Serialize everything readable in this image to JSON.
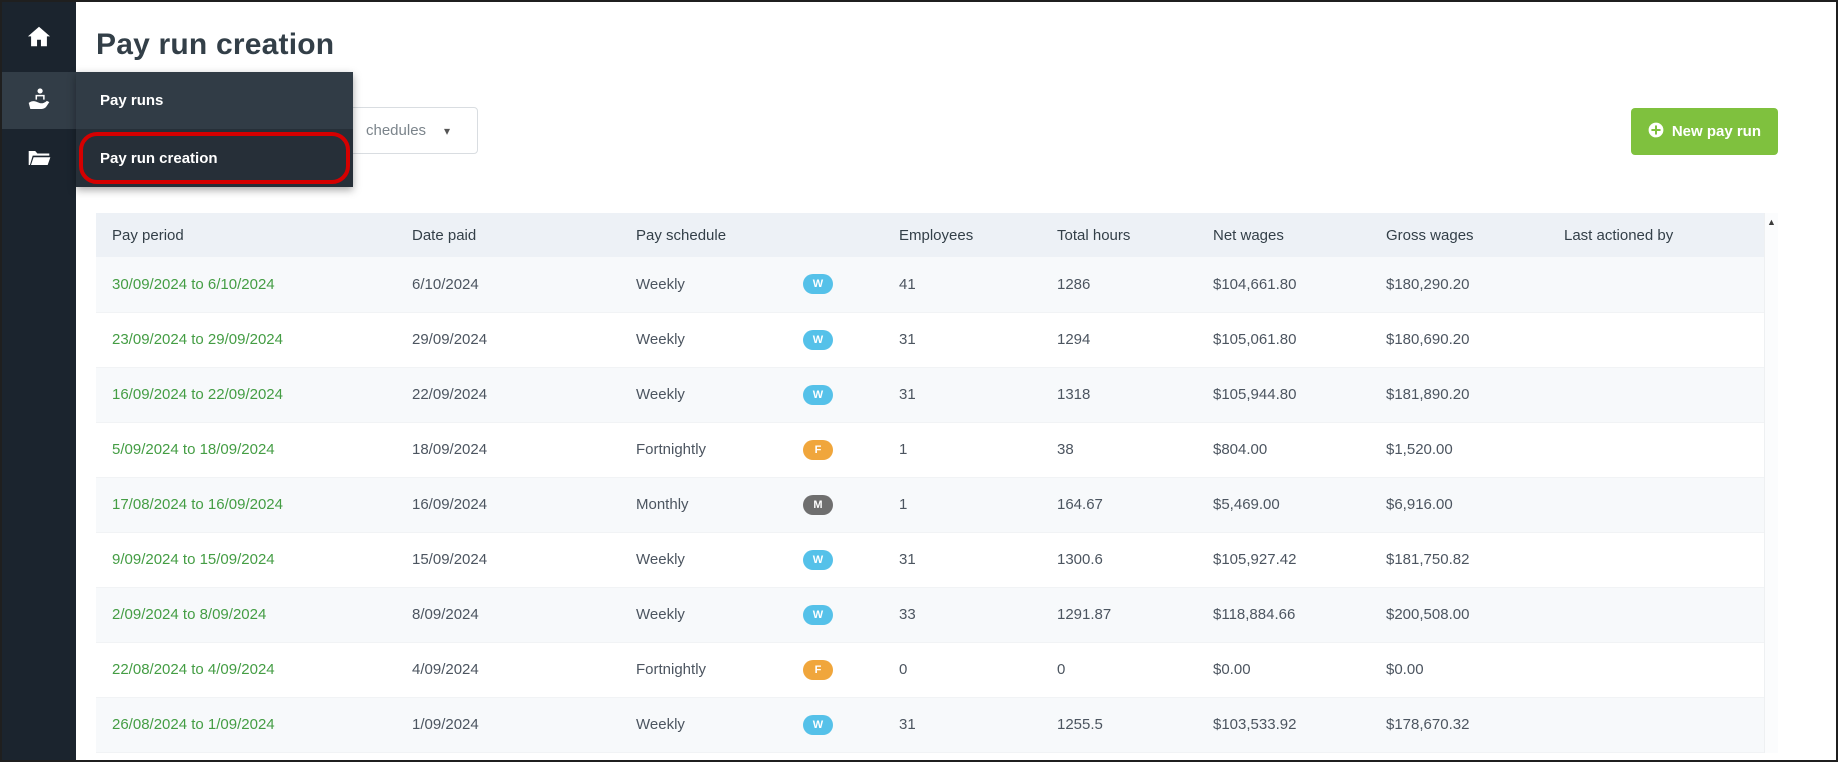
{
  "page": {
    "title": "Pay run creation"
  },
  "sidebar": {
    "icons": [
      "home",
      "pay-runs",
      "documents"
    ]
  },
  "flyout": {
    "items": [
      {
        "label": "Pay runs"
      },
      {
        "label": "Pay run creation",
        "annotated": true
      }
    ]
  },
  "toolbar": {
    "schedule_filter_visible_text": "chedules",
    "caret_glyph": "▾",
    "new_pay_run_label": "New pay run"
  },
  "scrollbar": {
    "up_arrow": "▲"
  },
  "colors": {
    "sidebar_bg": "#1b242e",
    "flyout_bg": "#313c46",
    "button_green": "#7fc13e",
    "link_green": "#449d44",
    "annotation_red": "#d50000",
    "badge_weekly": "#55c1e9",
    "badge_fortnightly": "#f0a63c",
    "badge_monthly": "#6f6f6f",
    "table_header_bg": "#edf1f6"
  },
  "table": {
    "headers": [
      "Pay period",
      "Date paid",
      "Pay schedule",
      "Employees",
      "Total hours",
      "Net wages",
      "Gross wages",
      "Last actioned by"
    ],
    "rows": [
      {
        "pay_period": "30/09/2024 to 6/10/2024",
        "date_paid": "6/10/2024",
        "schedule": "Weekly",
        "badge_letter": "W",
        "badge_color": "#55c1e9",
        "employees": "41",
        "total_hours": "1286",
        "net_wages": "$104,661.80",
        "gross_wages": "$180,290.20",
        "last_actioned_by": ""
      },
      {
        "pay_period": "23/09/2024 to 29/09/2024",
        "date_paid": "29/09/2024",
        "schedule": "Weekly",
        "badge_letter": "W",
        "badge_color": "#55c1e9",
        "employees": "31",
        "total_hours": "1294",
        "net_wages": "$105,061.80",
        "gross_wages": "$180,690.20",
        "last_actioned_by": ""
      },
      {
        "pay_period": "16/09/2024 to 22/09/2024",
        "date_paid": "22/09/2024",
        "schedule": "Weekly",
        "badge_letter": "W",
        "badge_color": "#55c1e9",
        "employees": "31",
        "total_hours": "1318",
        "net_wages": "$105,944.80",
        "gross_wages": "$181,890.20",
        "last_actioned_by": ""
      },
      {
        "pay_period": "5/09/2024 to 18/09/2024",
        "date_paid": "18/09/2024",
        "schedule": "Fortnightly",
        "badge_letter": "F",
        "badge_color": "#f0a63c",
        "employees": "1",
        "total_hours": "38",
        "net_wages": "$804.00",
        "gross_wages": "$1,520.00",
        "last_actioned_by": ""
      },
      {
        "pay_period": "17/08/2024 to 16/09/2024",
        "date_paid": "16/09/2024",
        "schedule": "Monthly",
        "badge_letter": "M",
        "badge_color": "#6f6f6f",
        "employees": "1",
        "total_hours": "164.67",
        "net_wages": "$5,469.00",
        "gross_wages": "$6,916.00",
        "last_actioned_by": ""
      },
      {
        "pay_period": "9/09/2024 to 15/09/2024",
        "date_paid": "15/09/2024",
        "schedule": "Weekly",
        "badge_letter": "W",
        "badge_color": "#55c1e9",
        "employees": "31",
        "total_hours": "1300.6",
        "net_wages": "$105,927.42",
        "gross_wages": "$181,750.82",
        "last_actioned_by": ""
      },
      {
        "pay_period": "2/09/2024 to 8/09/2024",
        "date_paid": "8/09/2024",
        "schedule": "Weekly",
        "badge_letter": "W",
        "badge_color": "#55c1e9",
        "employees": "33",
        "total_hours": "1291.87",
        "net_wages": "$118,884.66",
        "gross_wages": "$200,508.00",
        "last_actioned_by": ""
      },
      {
        "pay_period": "22/08/2024 to 4/09/2024",
        "date_paid": "4/09/2024",
        "schedule": "Fortnightly",
        "badge_letter": "F",
        "badge_color": "#f0a63c",
        "employees": "0",
        "total_hours": "0",
        "net_wages": "$0.00",
        "gross_wages": "$0.00",
        "last_actioned_by": ""
      },
      {
        "pay_period": "26/08/2024 to 1/09/2024",
        "date_paid": "1/09/2024",
        "schedule": "Weekly",
        "badge_letter": "W",
        "badge_color": "#55c1e9",
        "employees": "31",
        "total_hours": "1255.5",
        "net_wages": "$103,533.92",
        "gross_wages": "$178,670.32",
        "last_actioned_by": ""
      }
    ]
  }
}
